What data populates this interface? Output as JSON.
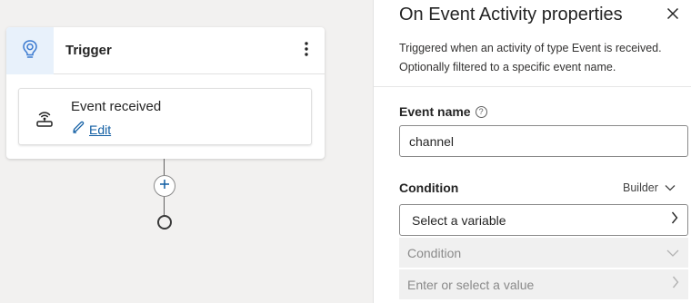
{
  "canvas": {
    "trigger": {
      "title": "Trigger",
      "event_card": {
        "title": "Event received",
        "edit_label": "Edit"
      }
    }
  },
  "panel": {
    "title": "On Event Activity properties",
    "description": "Triggered when an activity of type Event is received. Optionally filtered to a specific event name.",
    "event_name": {
      "label": "Event name",
      "value": "channel"
    },
    "condition": {
      "label": "Condition",
      "mode": "Builder",
      "variable_placeholder": "Select a variable",
      "operator_placeholder": "Condition",
      "value_placeholder": "Enter or select a value"
    }
  },
  "icons": {
    "trigger": "lightbulb-icon",
    "more": "more-vertical-icon",
    "event": "broadcast-icon",
    "edit": "pencil-icon",
    "add": "plus-icon",
    "close": "close-icon",
    "help": "help-circle-icon",
    "chevron_down": "chevron-down-icon",
    "chevron_right": "chevron-right-icon"
  },
  "colors": {
    "accent": "#115ea3",
    "trigger_icon_bg": "#e8f1fb",
    "canvas_bg": "#f2f1f0"
  }
}
